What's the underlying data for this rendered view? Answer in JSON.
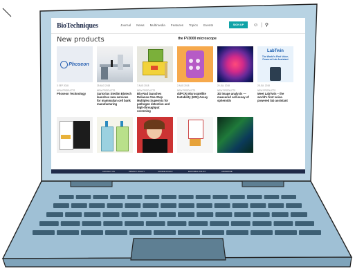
{
  "site": {
    "logo": "BioTechniques"
  },
  "nav": {
    "links": [
      "Journal",
      "News",
      "Multimedia",
      "Features",
      "Topics",
      "Events"
    ],
    "signup": "SIGN UP"
  },
  "page": {
    "section_title": "New products",
    "top_caption": "the FV3000 microscope"
  },
  "cards_row1": [
    {
      "date": "3 SEP 2018",
      "category": "NEW PRODUCTS",
      "title": "Phoseon Technology",
      "logo": "Phoseon"
    },
    {
      "date": "25 AUG 2018",
      "category": "NEW PRODUCTS",
      "title": "Sartorius Stedim Biotech launches new services for mammalian cell bank manufacturing"
    },
    {
      "date": "7 AUG 2018",
      "category": "NEW PRODUCTS",
      "title": "Bio-Rad launches Reliance One-Step Multiplex Supermix for pathogen detection and high-throughput screening"
    },
    {
      "date": "2 AUG 2018",
      "category": "NEW PRODUCTS",
      "title": "ddPCR Microsatellite Instability (MSI) Assay"
    },
    {
      "date": "20 JUL 2018",
      "category": "NEW PRODUCTS",
      "title": "3D image analysis — measured cell assay of spheroids"
    },
    {
      "date": "25 JUL 2018",
      "category": "NEW PRODUCTS",
      "title": "Meet LabTwin – the world's first voice-powered lab assistant",
      "logo": "LabTwin",
      "logo_sub": "The World's First Voice-Powered Lab Assistant"
    }
  ],
  "footer_links": [
    "CONTACT US",
    "PRIVACY POLICY",
    "COOKIE POLICY",
    "EDITORIAL POLICY",
    "ADVERTISE"
  ]
}
